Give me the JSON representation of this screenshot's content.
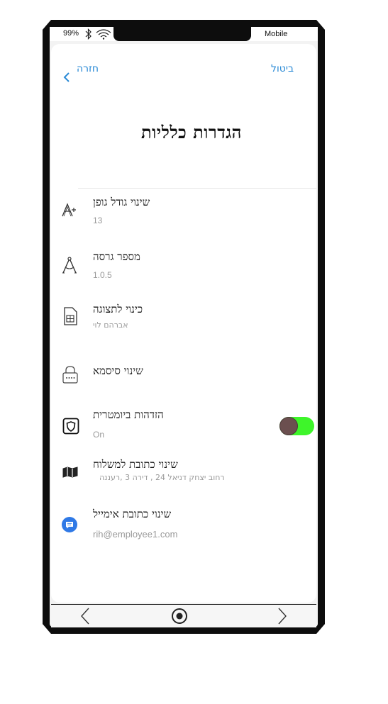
{
  "status_bar": {
    "battery": "99%",
    "carrier": "Mobile",
    "icons": [
      "bluetooth-icon",
      "wifi-icon"
    ]
  },
  "header": {
    "back_label": "חזרה",
    "cancel_label": "ביטול",
    "title": "הגדרות כלליות"
  },
  "settings": [
    {
      "label": "שינוי גודל גופן",
      "value": "13",
      "icon": "font-size-icon"
    },
    {
      "label": "מספר גרסה",
      "value": "1.0.5",
      "icon": "compass-icon"
    },
    {
      "label": "כינוי לתצוגה",
      "value": "אברהם לוי",
      "icon": "sim-card-icon"
    },
    {
      "label": "שינוי סיסמא",
      "value": "",
      "icon": "lock-icon"
    },
    {
      "label": "הזדהות ביומטרית",
      "value": "On",
      "icon": "shield-icon",
      "toggle": true
    },
    {
      "label": "שינוי כתובת למשלוח",
      "value": "רחוב יצחק דניאל 24 , דירה 3 ,רעננה",
      "icon": "map-icon"
    },
    {
      "label": "שינוי כתובת אימייל",
      "value": "rih@employee1.com",
      "icon": "message-icon"
    }
  ],
  "colors": {
    "link": "#2a8ad6",
    "toggle_on": "#3ef52a",
    "toggle_knob": "#6b4f4f",
    "message_icon": "#2f79e6"
  },
  "nav": {
    "buttons": [
      "back-chevron-icon",
      "home-circle-icon",
      "forward-chevron-icon"
    ]
  }
}
